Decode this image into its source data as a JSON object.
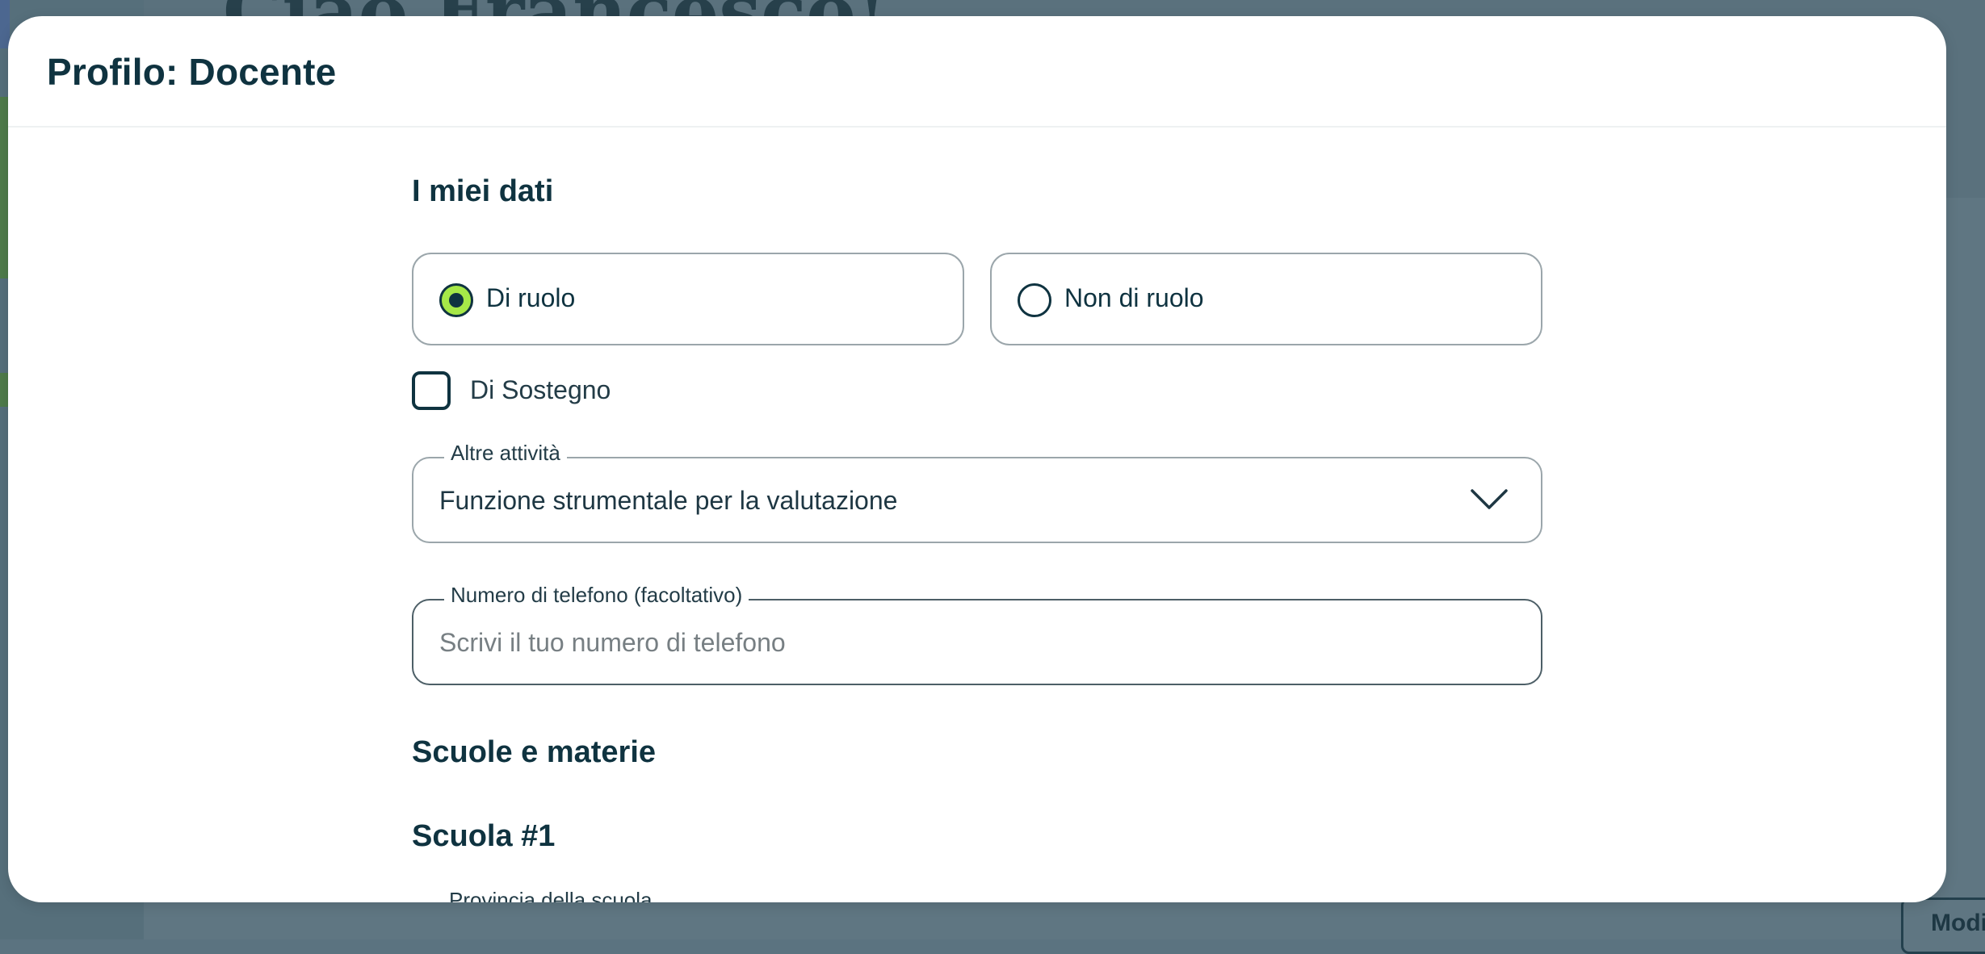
{
  "background": {
    "title": "Ciao Francesco!",
    "edit_button_label": "Modifica"
  },
  "modal": {
    "title": "Profilo: Docente"
  },
  "personal_data": {
    "heading": "I miei dati",
    "role_options": [
      {
        "label": "Di ruolo",
        "selected": true
      },
      {
        "label": "Non di ruolo",
        "selected": false
      }
    ],
    "support_checkbox": {
      "label": "Di Sostegno",
      "checked": false
    },
    "other_activities": {
      "label": "Altre attività",
      "value": "Funzione strumentale per la valutazione"
    },
    "phone": {
      "label": "Numero di telefono (facoltativo)",
      "value": "",
      "placeholder": "Scrivi il tuo numero di telefono"
    }
  },
  "schools": {
    "heading": "Scuole e materie",
    "school_1": {
      "heading": "Scuola #1",
      "province_label": "Provincia della scuola"
    }
  },
  "colors": {
    "primary_text": "#0f3340",
    "radio_selected": "#a6e848",
    "border": "#9ba6ab",
    "overlay": "#5f7682"
  }
}
